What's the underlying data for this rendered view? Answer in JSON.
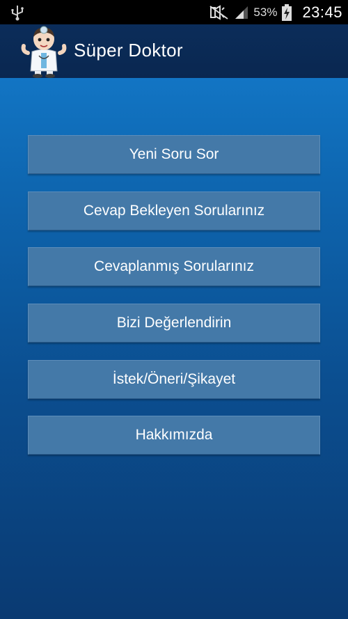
{
  "status_bar": {
    "battery_percent": "53%",
    "time": "23:45",
    "icons": [
      "usb-icon",
      "mute-icon",
      "signal-icon",
      "battery-charging-icon"
    ]
  },
  "app": {
    "title": "Süper Doktor",
    "logo": "doctor-mascot-icon"
  },
  "menu": {
    "items": [
      {
        "label": "Yeni Soru Sor"
      },
      {
        "label": "Cevap Bekleyen Sorularınız"
      },
      {
        "label": "Cevaplanmış Sorularınız"
      },
      {
        "label": "Bizi Değerlendirin"
      },
      {
        "label": "İstek/Öneri/Şikayet"
      },
      {
        "label": "Hakkımızda"
      }
    ]
  },
  "colors": {
    "button_bg": "#4479a8",
    "action_bar": "#0b2d5a",
    "content_top": "#1275c4",
    "content_bottom": "#0a3a72"
  }
}
